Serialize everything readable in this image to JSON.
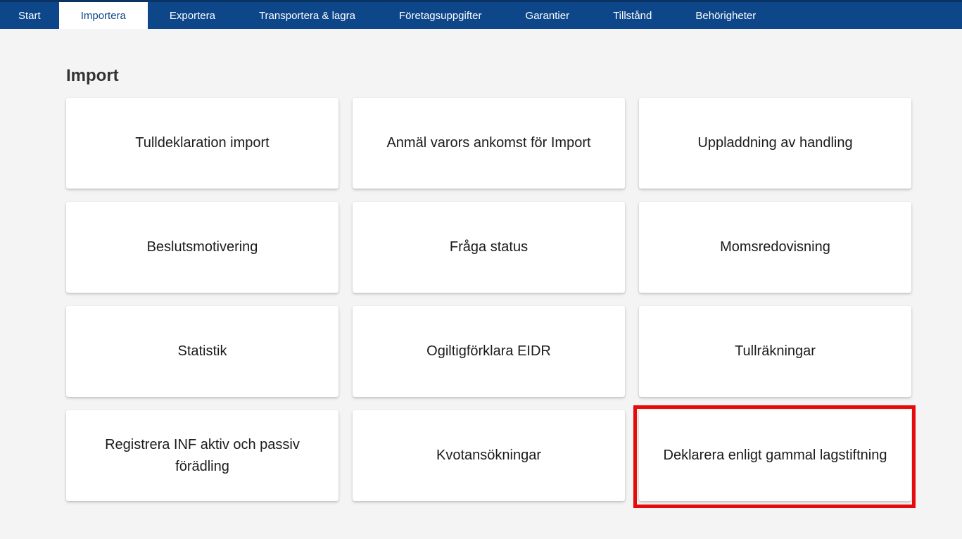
{
  "nav": {
    "items": [
      {
        "label": "Start",
        "active": false
      },
      {
        "label": "Importera",
        "active": true
      },
      {
        "label": "Exportera",
        "active": false
      },
      {
        "label": "Transportera & lagra",
        "active": false
      },
      {
        "label": "Företagsuppgifter",
        "active": false
      },
      {
        "label": "Garantier",
        "active": false
      },
      {
        "label": "Tillstånd",
        "active": false
      },
      {
        "label": "Behörigheter",
        "active": false
      }
    ]
  },
  "page": {
    "title": "Import"
  },
  "cards": [
    {
      "label": "Tulldeklaration import",
      "highlighted": false
    },
    {
      "label": "Anmäl varors ankomst för Import",
      "highlighted": false
    },
    {
      "label": "Uppladdning av handling",
      "highlighted": false
    },
    {
      "label": "Beslutsmotivering",
      "highlighted": false
    },
    {
      "label": "Fråga status",
      "highlighted": false
    },
    {
      "label": "Momsredovisning",
      "highlighted": false
    },
    {
      "label": "Statistik",
      "highlighted": false
    },
    {
      "label": "Ogiltigförklara EIDR",
      "highlighted": false
    },
    {
      "label": "Tullräkningar",
      "highlighted": false
    },
    {
      "label": "Registrera INF aktiv och passiv förädling",
      "highlighted": false
    },
    {
      "label": "Kvotansökningar",
      "highlighted": false
    },
    {
      "label": "Deklarera enligt gammal lagstiftning",
      "highlighted": true
    }
  ],
  "colors": {
    "nav_background": "#0d4689",
    "nav_top_strip": "#0a3263",
    "active_tab_background": "#ffffff",
    "active_tab_text": "#0d4689",
    "page_background": "#f4f4f4",
    "card_background": "#ffffff",
    "card_text": "#1b1b1b",
    "heading_text": "#333333",
    "highlight_border": "#e60b0b"
  }
}
